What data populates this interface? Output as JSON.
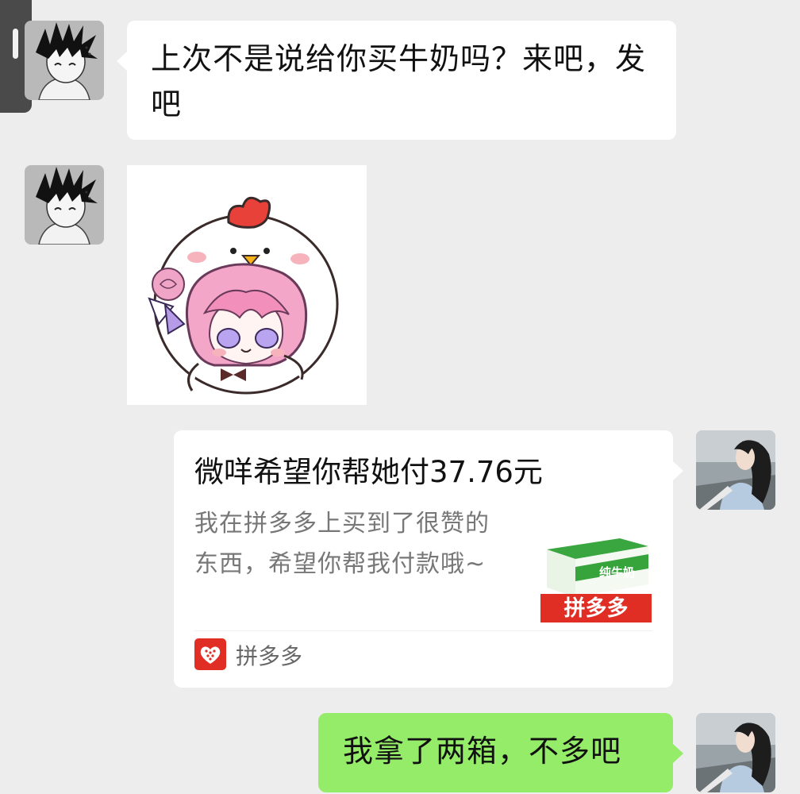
{
  "messages": [
    {
      "sender": "friend",
      "type": "text",
      "text": "上次不是说给你买牛奶吗？来吧，发吧"
    },
    {
      "sender": "friend",
      "type": "sticker",
      "sticker": "pink-hair-girl-chicken-hat-sticker"
    },
    {
      "sender": "me",
      "type": "payment_request",
      "title": "微咩希望你帮她付37.76元",
      "description": "我在拼多多上买到了很赞的东西，希望你帮我付款哦~",
      "thumbnail": {
        "product_label": "纯牛奶",
        "brand_banner": "拼多多"
      },
      "source": "拼多多"
    },
    {
      "sender": "me",
      "type": "text",
      "text": "我拿了两箱，不多吧"
    }
  ],
  "colors": {
    "background": "#ededed",
    "incoming_bubble": "#ffffff",
    "outgoing_bubble": "#95ec69",
    "pinduoduo_red": "#e02e24"
  },
  "icons": {
    "friend_avatar": "spiky-hair-boy-avatar",
    "my_avatar": "girl-long-hair-avatar",
    "source_icon": "pinduoduo-heart-icon"
  }
}
